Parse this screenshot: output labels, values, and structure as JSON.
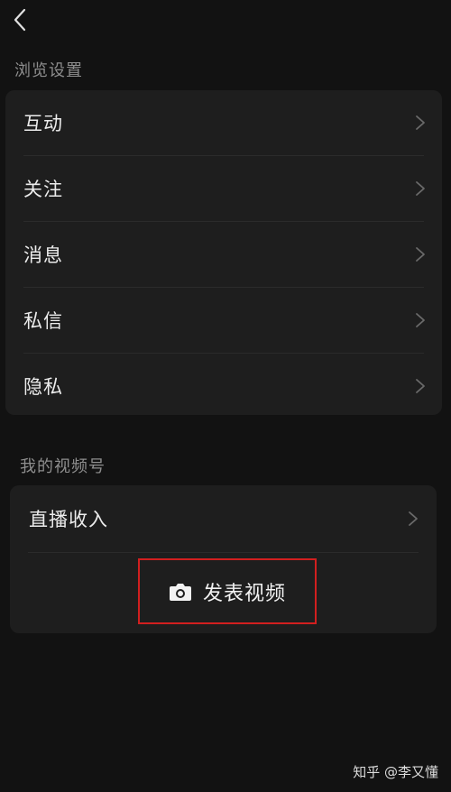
{
  "browse_section": {
    "title": "浏览设置",
    "items": [
      {
        "label": "互动"
      },
      {
        "label": "关注"
      },
      {
        "label": "消息"
      },
      {
        "label": "私信"
      },
      {
        "label": "隐私"
      }
    ]
  },
  "channel_section": {
    "title": "我的视频号",
    "items": [
      {
        "label": "直播收入"
      }
    ],
    "publish_label": "发表视频"
  },
  "watermark": "知乎 @李又懂",
  "colors": {
    "background": "#121212",
    "card": "#1e1e1e",
    "highlight_border": "#d21f1f"
  },
  "icons": {
    "back": "chevron-left-icon",
    "row_arrow": "chevron-right-icon",
    "publish": "camera-icon"
  }
}
